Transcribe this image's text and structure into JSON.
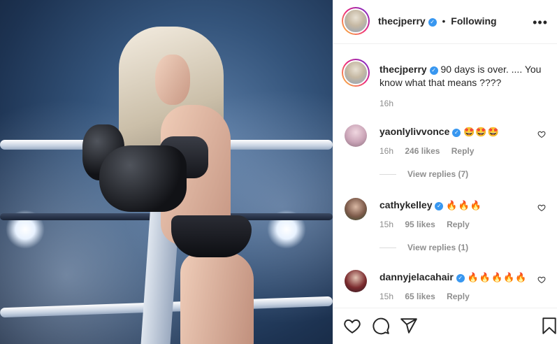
{
  "post_author": {
    "username": "thecjperry",
    "follow_status": "Following",
    "more_icon": "more-options-icon"
  },
  "caption": {
    "username": "thecjperry",
    "text": "90 days is over. .... You know what that means ????",
    "time": "16h"
  },
  "comments": [
    {
      "username": "yaonlylivvonce",
      "text": "🤩🤩🤩",
      "time": "16h",
      "likes": "246 likes",
      "reply": "Reply",
      "view_replies": "View replies (7)"
    },
    {
      "username": "cathykelley",
      "text": "🔥🔥🔥",
      "time": "15h",
      "likes": "95 likes",
      "reply": "Reply",
      "view_replies": "View replies (1)"
    },
    {
      "username": "dannyjelacahair",
      "text": "🔥🔥🔥🔥🔥",
      "time": "15h",
      "likes": "65 likes",
      "reply": "Reply"
    }
  ],
  "actions": {
    "like_icon": "heart-icon",
    "comment_icon": "comment-icon",
    "share_icon": "share-icon",
    "save_icon": "bookmark-icon"
  },
  "colors": {
    "verified": "#3897f0",
    "muted": "#8e8e8e",
    "text": "#262626",
    "border": "#efefef"
  }
}
